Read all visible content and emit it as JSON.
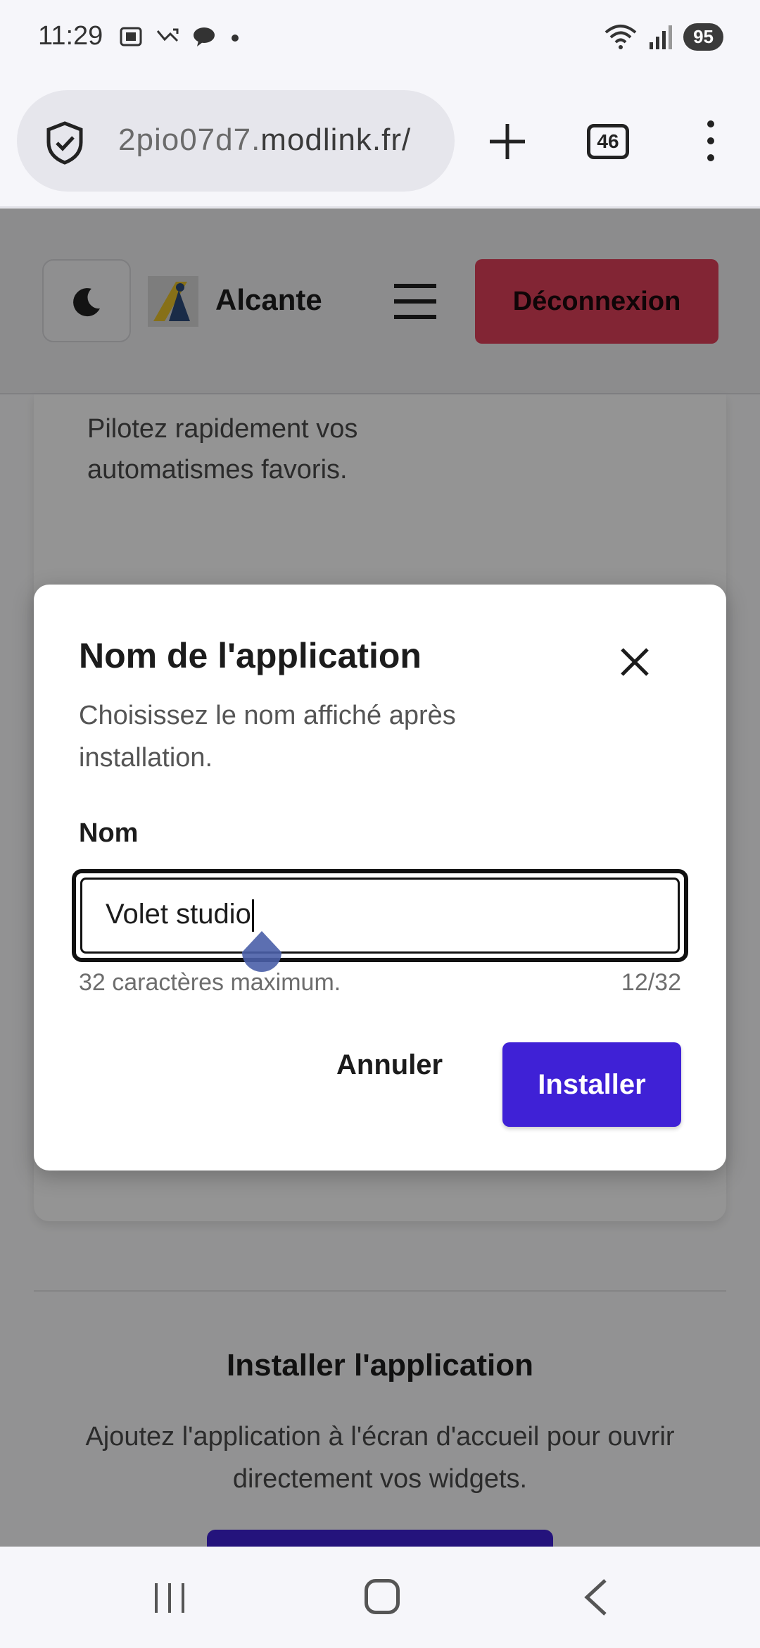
{
  "status_bar": {
    "time": "11:29",
    "battery": "95",
    "left_icons": [
      "screenshot-icon",
      "missed-call-icon",
      "chat-icon",
      "dot-icon"
    ],
    "right_icons": [
      "wifi-icon",
      "signal-icon"
    ]
  },
  "browser": {
    "url_prefix": "2pio07d7.",
    "url_domain": "modlink.fr/",
    "tab_count": "46"
  },
  "header": {
    "brand": "Alcante",
    "logout_label": "Déconnexion"
  },
  "card": {
    "text": "Pilotez rapidement vos automatismes favoris."
  },
  "install_section": {
    "title": "Installer l'application",
    "description": "Ajoutez l'application à l'écran d'accueil pour ouvrir directement vos widgets."
  },
  "dialog": {
    "title": "Nom de l'application",
    "description": "Choisissez le nom affiché après installation.",
    "field_label": "Nom",
    "field_value": "Volet studio",
    "hint": "32 caractères maximum.",
    "counter": "12/32",
    "cancel_label": "Annuler",
    "install_label": "Installer"
  },
  "colors": {
    "primary": "#3f21d6",
    "danger": "#e0405a"
  }
}
